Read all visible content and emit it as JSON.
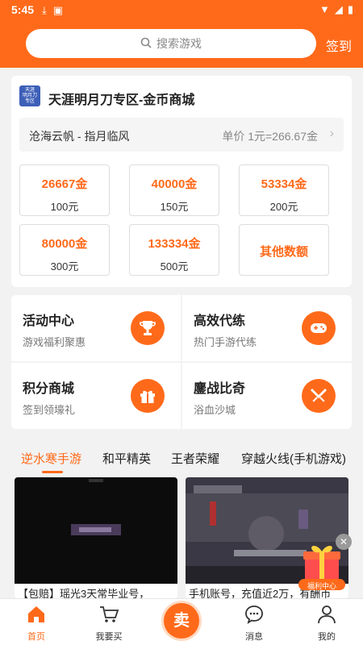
{
  "status_bar": {
    "time": "5:45"
  },
  "header": {
    "search_placeholder": "搜索游戏",
    "checkin_label": "签到"
  },
  "shop": {
    "logo_lines": [
      "天涯",
      "明月刀",
      "专区"
    ],
    "title": "天涯明月刀专区-金币商城",
    "server": "沧海云帆 - 指月临风",
    "price": "单价 1元=266.67金",
    "packages": [
      {
        "gold": "26667金",
        "price": "100元"
      },
      {
        "gold": "40000金",
        "price": "150元"
      },
      {
        "gold": "53334金",
        "price": "200元"
      },
      {
        "gold": "80000金",
        "price": "300元"
      },
      {
        "gold": "133334金",
        "price": "500元"
      }
    ],
    "other_label": "其他数额"
  },
  "features": [
    {
      "title": "活动中心",
      "subtitle": "游戏福利聚惠",
      "icon": "trophy-icon"
    },
    {
      "title": "高效代练",
      "subtitle": "热门手游代练",
      "icon": "gamepad-icon"
    },
    {
      "title": "积分商城",
      "subtitle": "签到领壕礼",
      "icon": "gift-icon"
    },
    {
      "title": "鏖战比奇",
      "subtitle": "浴血沙城",
      "icon": "swords-icon"
    }
  ],
  "game_tabs": [
    "逆水寒手游",
    "和平精英",
    "王者荣耀",
    "穿越火线(手机游戏)"
  ],
  "listings": [
    {
      "caption": "【包赔】瑶光3天常毕业号，"
    },
    {
      "caption": "手机账号，充值近2万，有酬币"
    }
  ],
  "floating_badge": {
    "label": "福利中心"
  },
  "bottom_nav": {
    "home": "首页",
    "buy": "我要买",
    "sell": "卖",
    "messages": "消息",
    "mine": "我的"
  },
  "colors": {
    "accent": "#ff6a1a"
  }
}
